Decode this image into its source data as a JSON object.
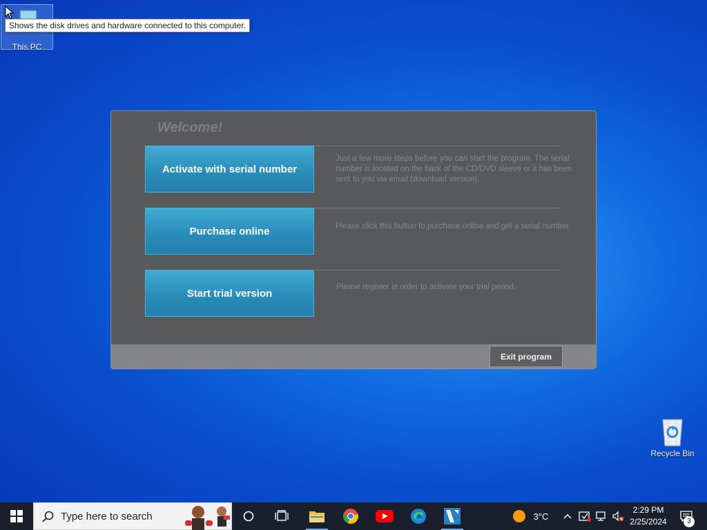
{
  "desktop": {
    "icons": {
      "this_pc": "This PC",
      "recycle_bin": "Recycle Bin"
    },
    "tooltip": "Shows the disk drives and hardware connected to this computer."
  },
  "app": {
    "welcome": "Welcome!",
    "actions": [
      {
        "label": "Activate with serial number",
        "description": "Just a few more steps before you can start the program. The serial number is located on the back of the CD/DVD sleeve or it has been sent to you via email (download version)."
      },
      {
        "label": "Purchase online",
        "description": "Please click this button to purchase online and get a serial number."
      },
      {
        "label": "Start trial version",
        "description": "Please register in order to activate your trial period."
      }
    ],
    "exit_label": "Exit program"
  },
  "taskbar": {
    "search_placeholder": "Type here to search",
    "weather": "3°C",
    "time": "2:29 PM",
    "date": "2/25/2024",
    "notification_count": "3",
    "pinned_icons": [
      "task-view-icon",
      "file-explorer-icon",
      "chrome-icon",
      "youtube-icon",
      "edge-icon",
      "app-icon"
    ]
  },
  "colors": {
    "desktop_blue": "#0a4fcf",
    "dialog_bg": "#58595b",
    "button_teal": "#2a8dba",
    "taskbar_bg": "#1a1f2c"
  }
}
